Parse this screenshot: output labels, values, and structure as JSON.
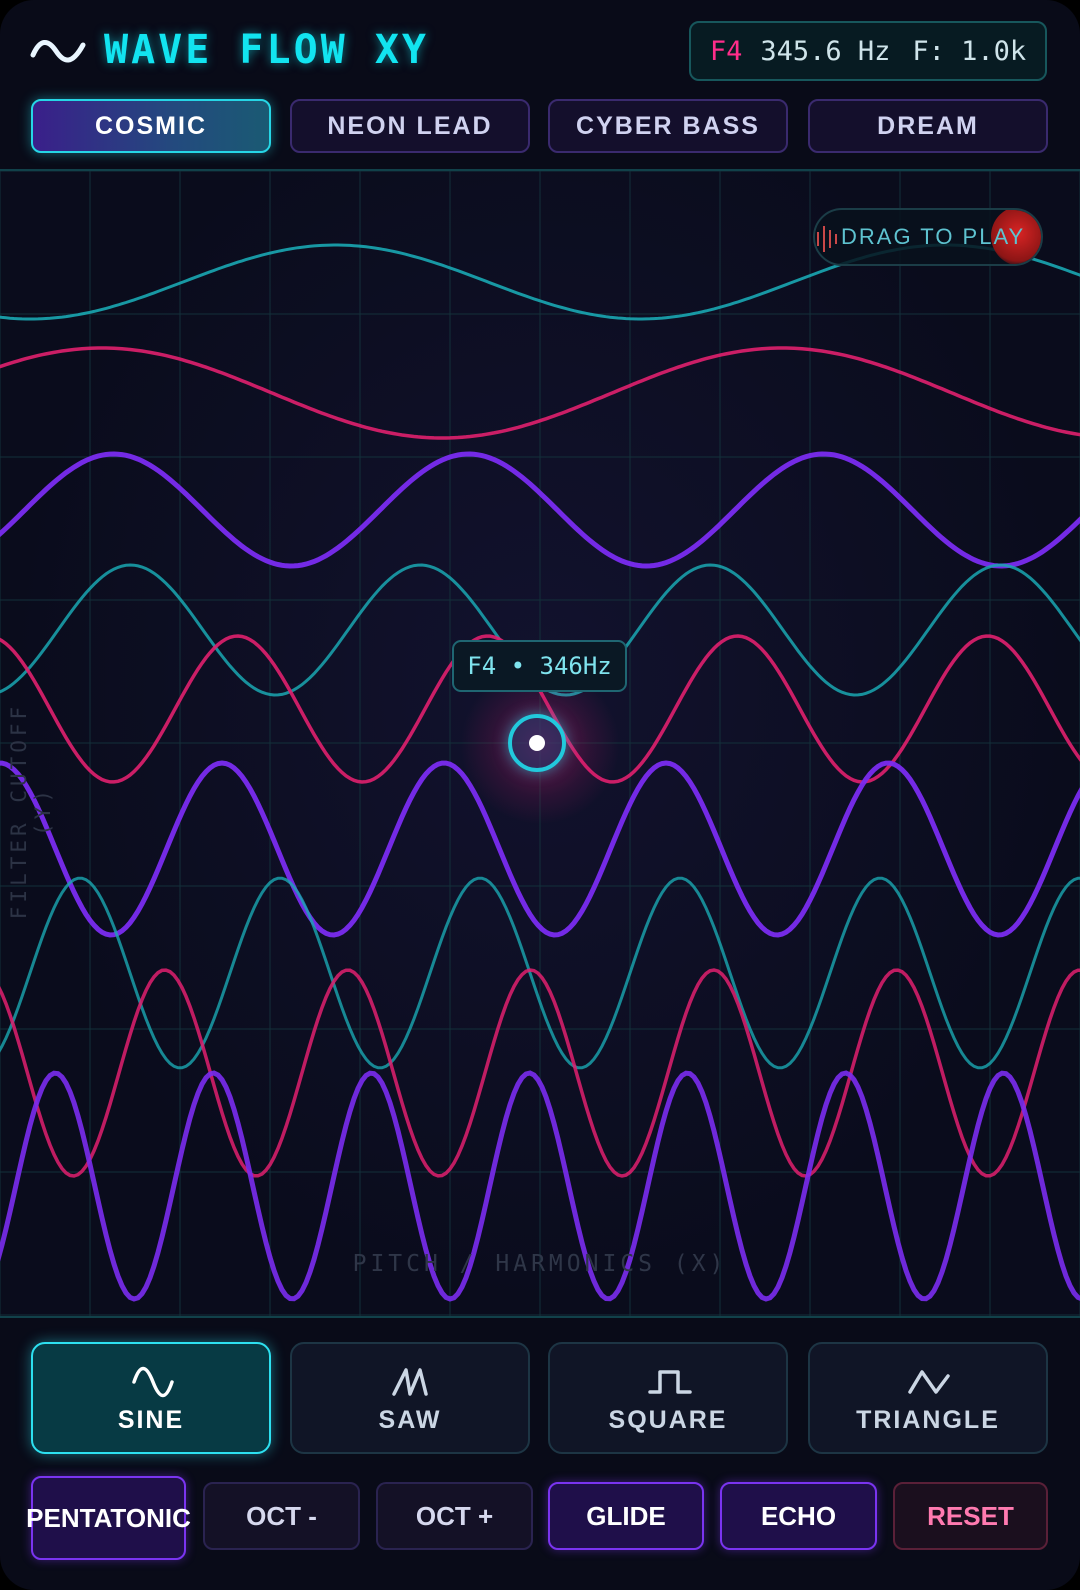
{
  "header": {
    "title": "WAVE FLOW XY",
    "readout": {
      "note": "F4",
      "frequency": "345.6 Hz",
      "filter": "F: 1.0k"
    }
  },
  "presets": [
    {
      "label": "COSMIC",
      "active": true
    },
    {
      "label": "NEON LEAD",
      "active": false
    },
    {
      "label": "CYBER BASS",
      "active": false
    },
    {
      "label": "DREAM",
      "active": false
    }
  ],
  "xy_pad": {
    "y_axis_label": "FILTER CUTOFF (Y)",
    "x_axis_label": "PITCH / HARMONICS (X)",
    "drag_hint": "DRAG TO PLAY",
    "tooltip": "F4 • 346Hz"
  },
  "waveforms": [
    {
      "label": "SINE",
      "icon": "sine-wave-icon",
      "active": true
    },
    {
      "label": "SAW",
      "icon": "saw-wave-icon",
      "active": false
    },
    {
      "label": "SQUARE",
      "icon": "square-wave-icon",
      "active": false
    },
    {
      "label": "TRIANGLE",
      "icon": "triangle-wave-icon",
      "active": false
    }
  ],
  "controls": {
    "pentatonic": "PENTATONIC",
    "oct_down": "OCT -",
    "oct_up": "OCT +",
    "glide": "GLIDE",
    "echo": "ECHO",
    "reset": "RESET"
  },
  "colors": {
    "cyan": "#12e4f0",
    "magenta": "#e0206e",
    "purple": "#7a2cf0",
    "teal": "#1aa7b2",
    "background": "#090b18"
  }
}
